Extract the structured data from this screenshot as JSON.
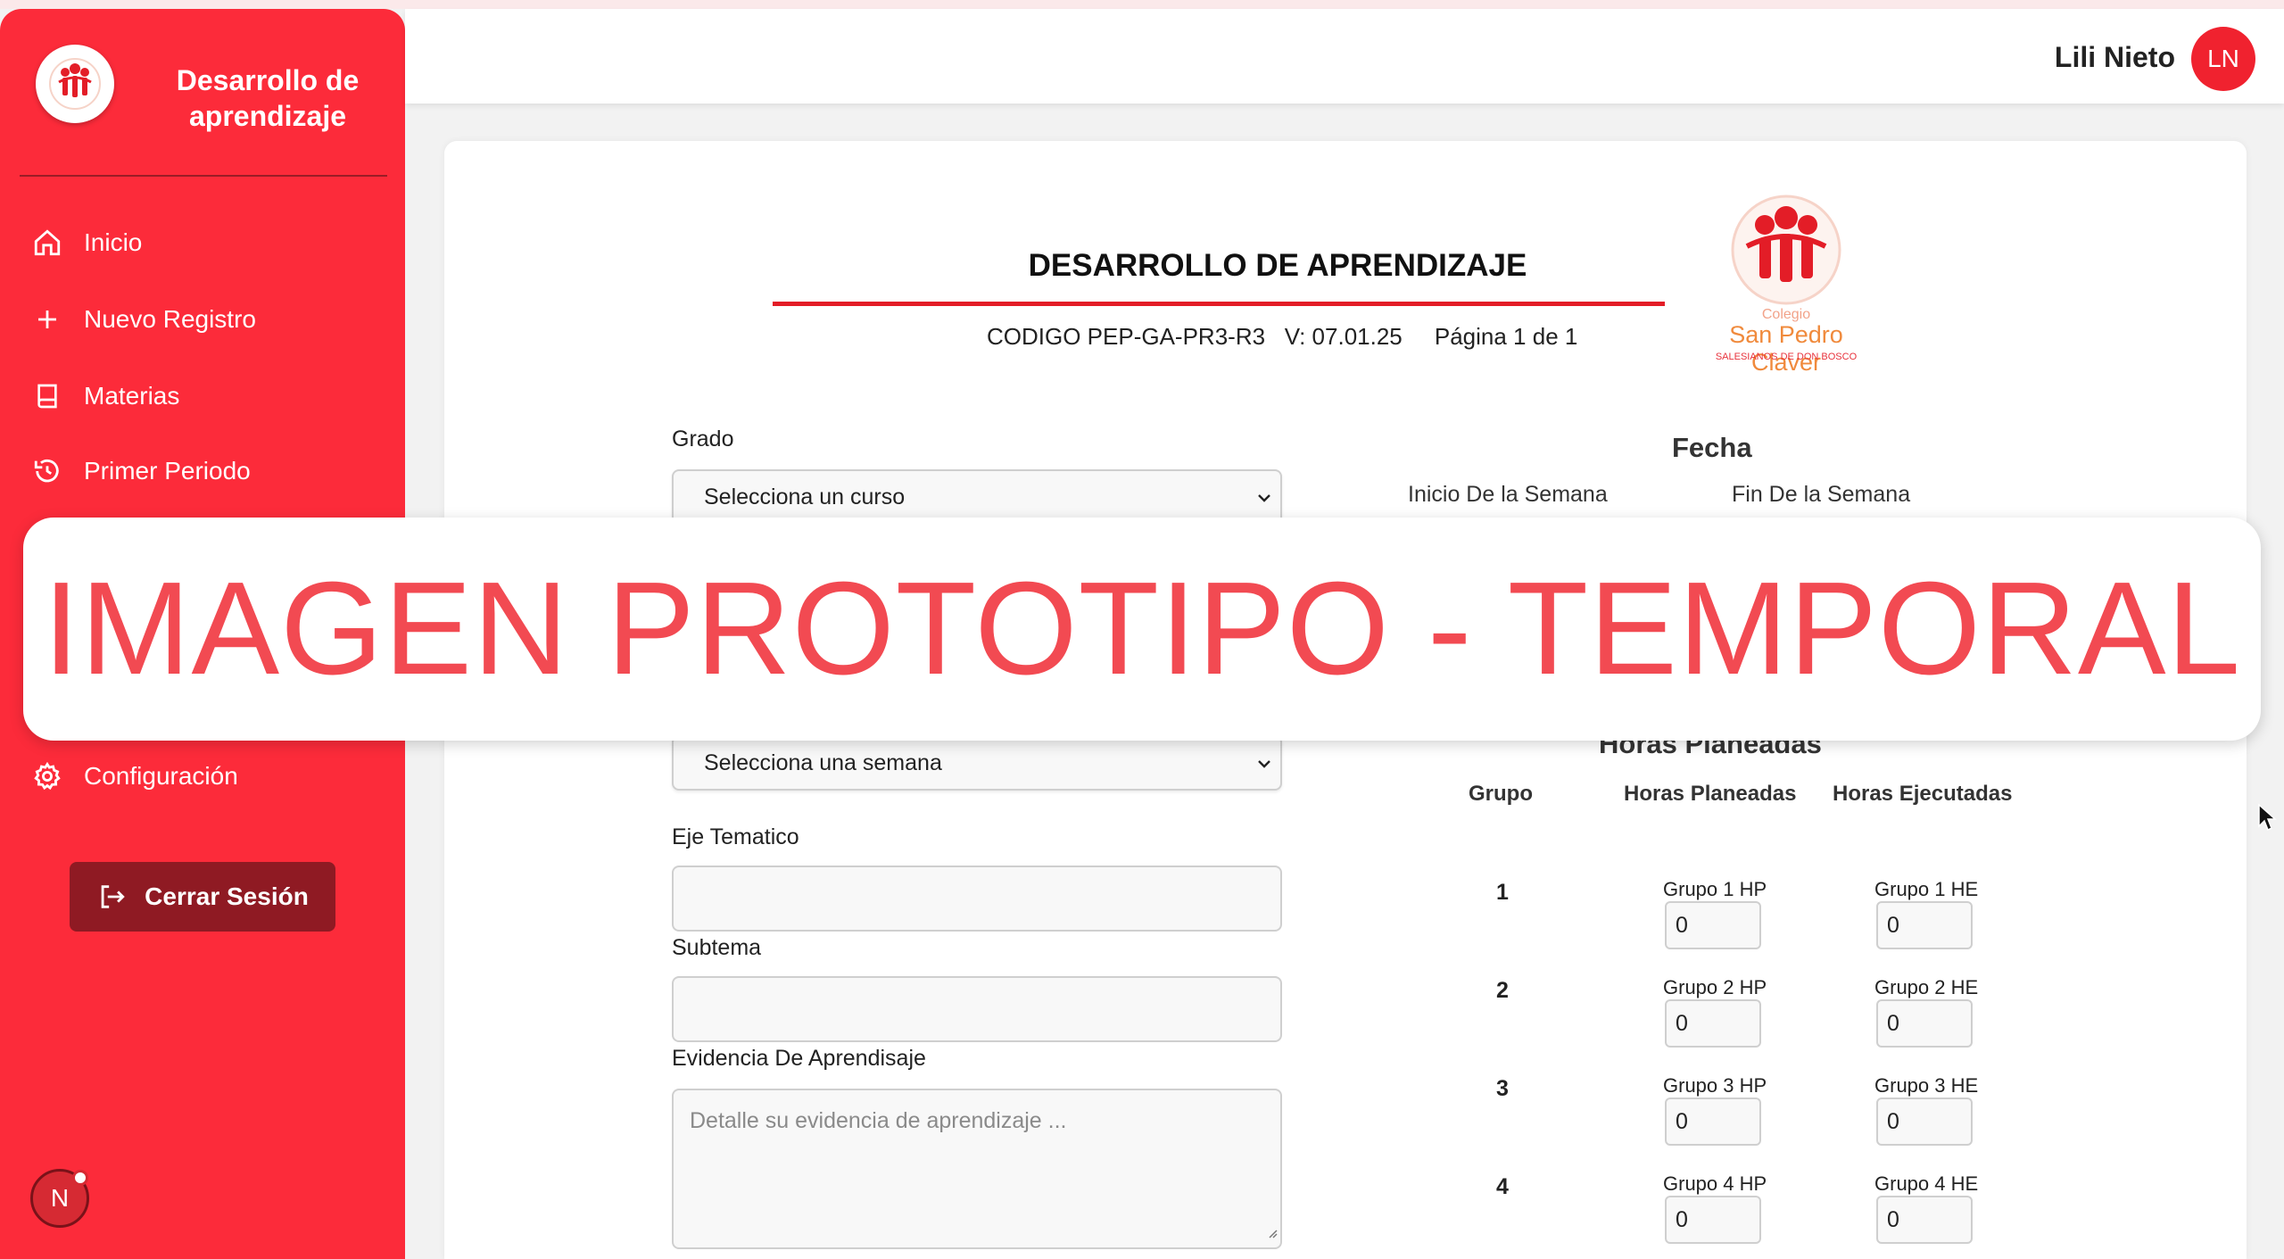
{
  "app": {
    "brand_title": "Desarrollo de aprendizaje"
  },
  "sidebar": {
    "items": [
      {
        "label": "Inicio",
        "icon": "home-icon"
      },
      {
        "label": "Nuevo Registro",
        "icon": "plus-icon"
      },
      {
        "label": "Materias",
        "icon": "book-icon"
      },
      {
        "label": "Primer Periodo",
        "icon": "history-icon"
      },
      {
        "label": "Configuración",
        "icon": "gear-icon"
      }
    ],
    "logout_label": "Cerrar Sesión",
    "badge_letter": "N"
  },
  "header": {
    "user_name": "Lili Nieto",
    "user_initials": "LN"
  },
  "document": {
    "title": "DESARROLLO DE APRENDIZAJE",
    "code_line": "CODIGO PEP-GA-PR3-R3   V: 07.01.25     Página 1 de 1",
    "logo_colegio": "Colegio",
    "logo_name": "San Pedro Claver",
    "logo_sub": "SALESIANOS DE DON BOSCO"
  },
  "form": {
    "grado_label": "Grado",
    "grado_value": "Selecciona un curso",
    "semana_value": "Selecciona una semana",
    "eje_label": "Eje Tematico",
    "subtema_label": "Subtema",
    "evidencia_label": "Evidencia De Aprendisaje",
    "evidencia_placeholder": "Detalle su evidencia de aprendizaje ..."
  },
  "fecha": {
    "title": "Fecha",
    "inicio_label": "Inicio De la Semana",
    "fin_label": "Fin De la Semana"
  },
  "horas": {
    "title": "Horas Planeadas",
    "col_grupo": "Grupo",
    "col_planeadas": "Horas Planeadas",
    "col_ejecutadas": "Horas Ejecutadas",
    "rows": [
      {
        "grupo": "1",
        "hp_label": "Grupo 1 HP",
        "hp_value": "0",
        "he_label": "Grupo 1 HE",
        "he_value": "0"
      },
      {
        "grupo": "2",
        "hp_label": "Grupo 2 HP",
        "hp_value": "0",
        "he_label": "Grupo 2 HE",
        "he_value": "0"
      },
      {
        "grupo": "3",
        "hp_label": "Grupo 3 HP",
        "hp_value": "0",
        "he_label": "Grupo 3 HE",
        "he_value": "0"
      },
      {
        "grupo": "4",
        "hp_label": "Grupo 4 HP",
        "hp_value": "0",
        "he_label": "Grupo 4 HE",
        "he_value": "0"
      }
    ]
  },
  "overlay": {
    "text": "IMAGEN PROTOTIPO - TEMPORAL"
  },
  "colors": {
    "sidebar": "#fc2b3a",
    "accent": "#e31d27",
    "logout": "#8f1a23",
    "overlay_text": "#f24a52"
  }
}
